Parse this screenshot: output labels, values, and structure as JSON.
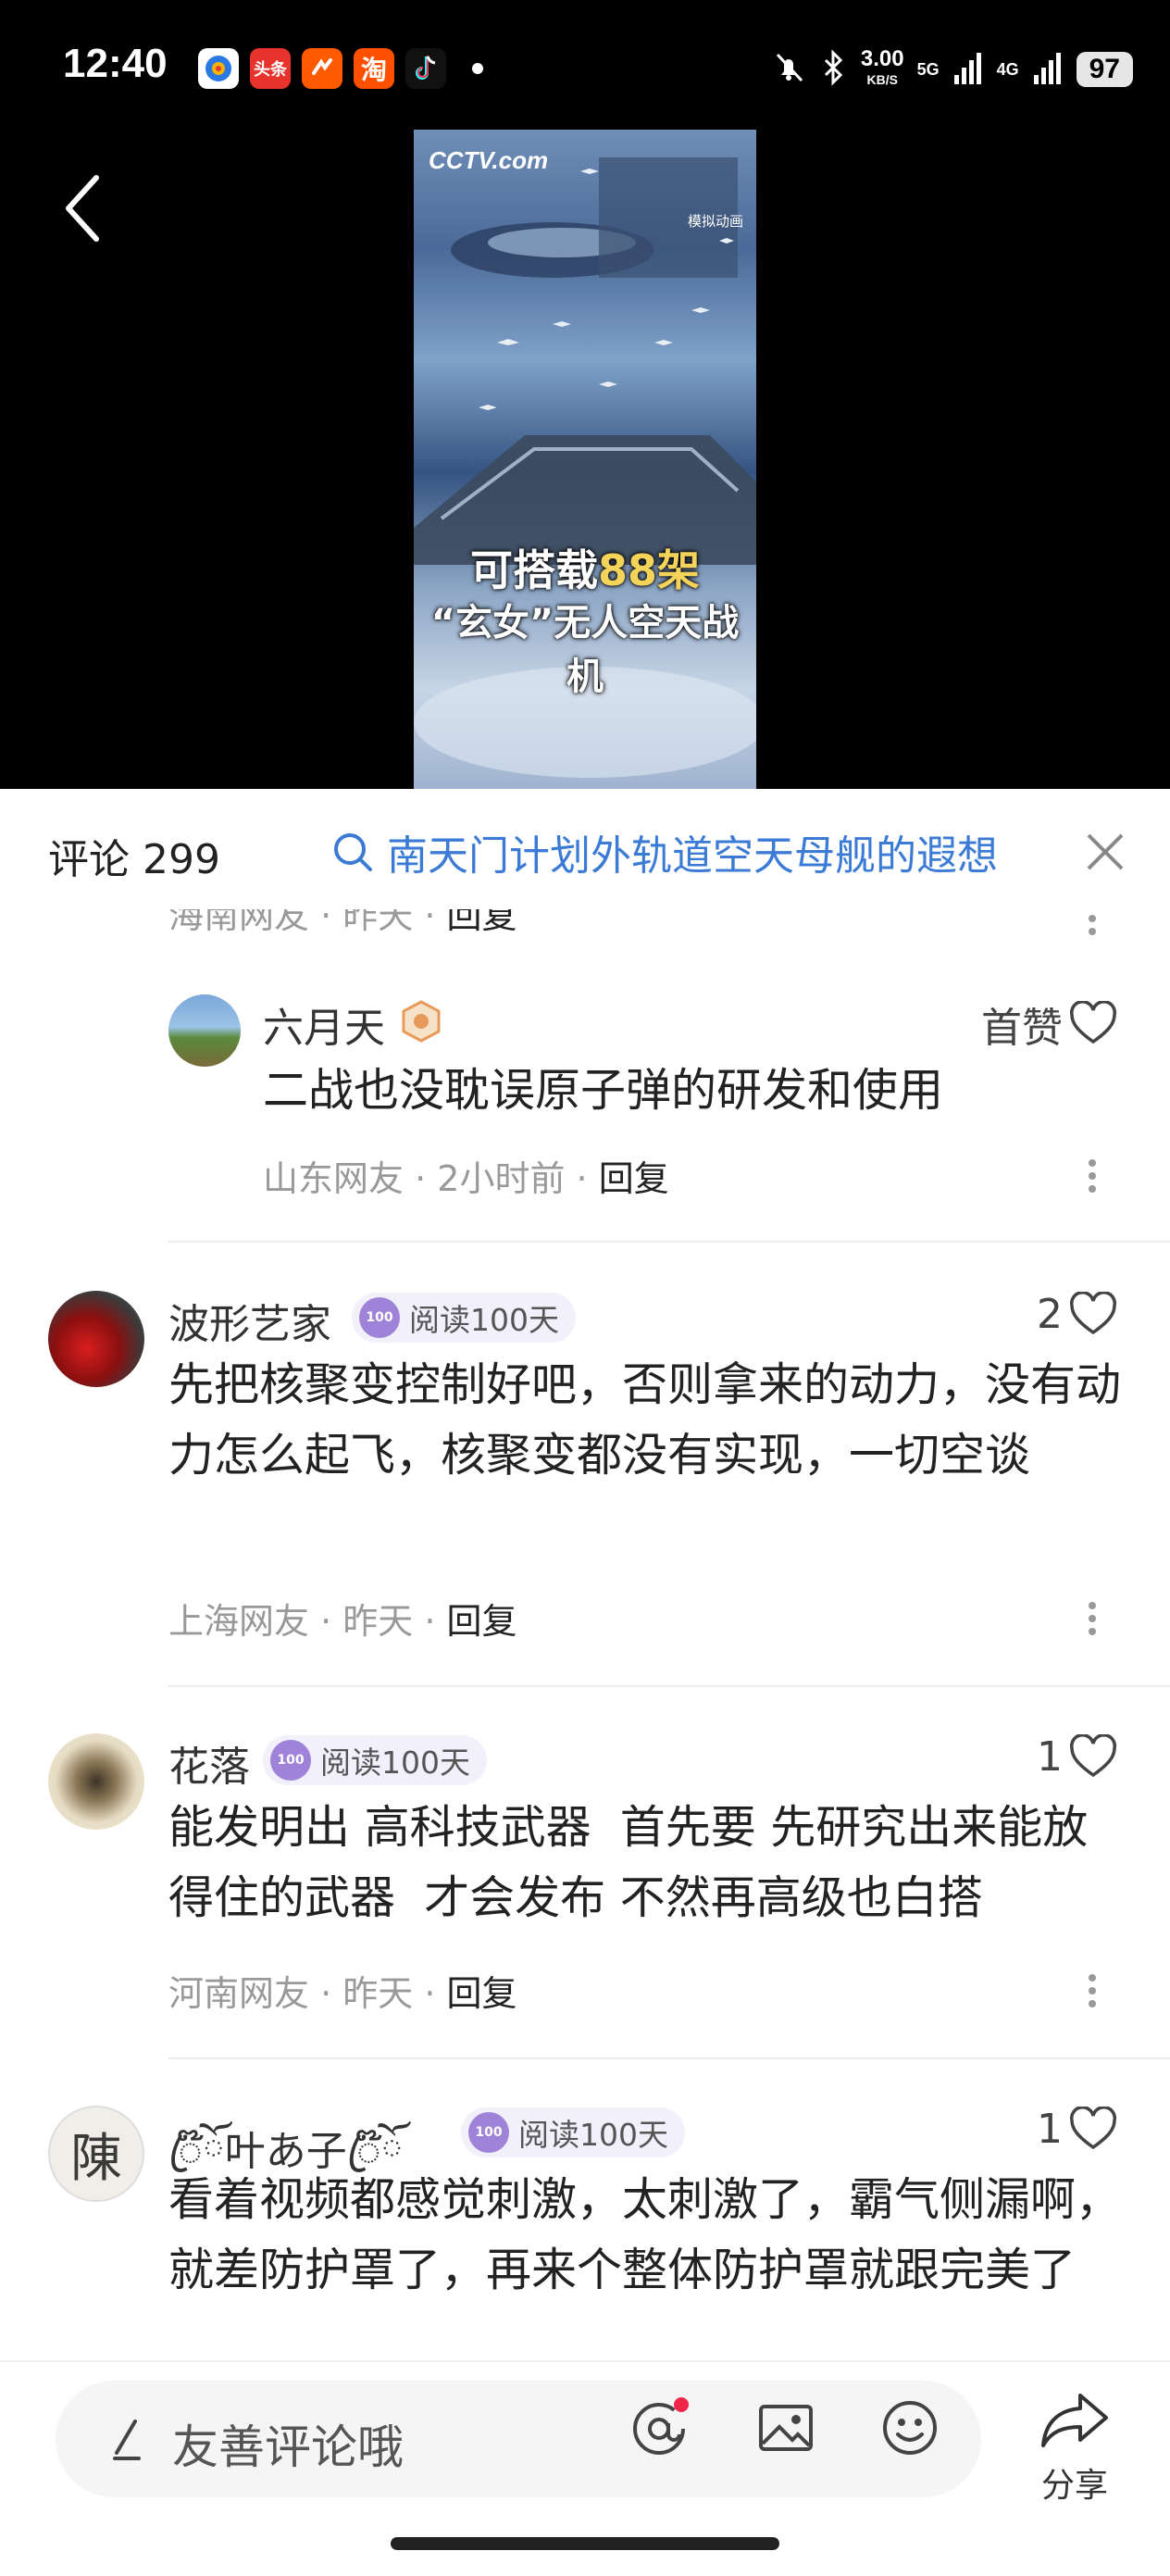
{
  "status_bar": {
    "time": "12:40",
    "apps": [
      "tencent-news-icon",
      "toutiao-icon",
      "taobao-tejia-icon",
      "taobao-icon",
      "tiktok-icon"
    ],
    "toutiao_label": "头条",
    "taobao_label": "淘",
    "net_speed_value": "3.00",
    "net_speed_unit": "KB/S",
    "net1": "5G",
    "net2": "4G",
    "battery": "97"
  },
  "video": {
    "logo": "CCTV.com",
    "corner_label": "模拟动画",
    "caption_prefix": "可搭载",
    "caption_number": "88架",
    "caption_line2": "“玄女”无人空天战机"
  },
  "comments_header": {
    "title": "评论 299",
    "search_text": "南天门计划外轨道空天母舰的遐想"
  },
  "partial_meta": {
    "location": "海南网友",
    "time": "昨天",
    "reply": "回复"
  },
  "comments": [
    {
      "username": "六月天",
      "like_label": "首赞",
      "text": "二战也没耽误原子弹的研发和使用",
      "location": "山东网友",
      "time": "2小时前",
      "reply": "回复"
    },
    {
      "username": "波形艺家",
      "badge": "阅读100天",
      "likes": "2",
      "text": "先把核聚变控制好吧，否则拿来的动力，没有动力怎么起飞，核聚变都没有实现，一切空谈",
      "location": "上海网友",
      "time": "昨天",
      "reply": "回复"
    },
    {
      "username": "花落",
      "badge": "阅读100天",
      "likes": "1",
      "text": "能发明出 高科技武器  首先要 先研究出来能放得住的武器  才会发布 不然再高级也白搭",
      "location": "河南网友",
      "time": "昨天",
      "reply": "回复"
    },
    {
      "username": "ꦿ໊ོ叶あ子ꦿ໊ོ",
      "badge": "阅读100天",
      "likes": "1",
      "text": "看着视频都感觉刺激，太刺激了，霸气侧漏啊，就差防护罩了，再来个整体防护罩就跟完美了",
      "avatar_char": "陳"
    }
  ],
  "badge_icon_text": "100",
  "bottom_bar": {
    "input_placeholder": "友善评论哦",
    "share_label": "分享"
  },
  "colors": {
    "link_blue": "#3b7bd6",
    "badge_purple": "#9f83d9",
    "notification_red": "#f0264b"
  }
}
